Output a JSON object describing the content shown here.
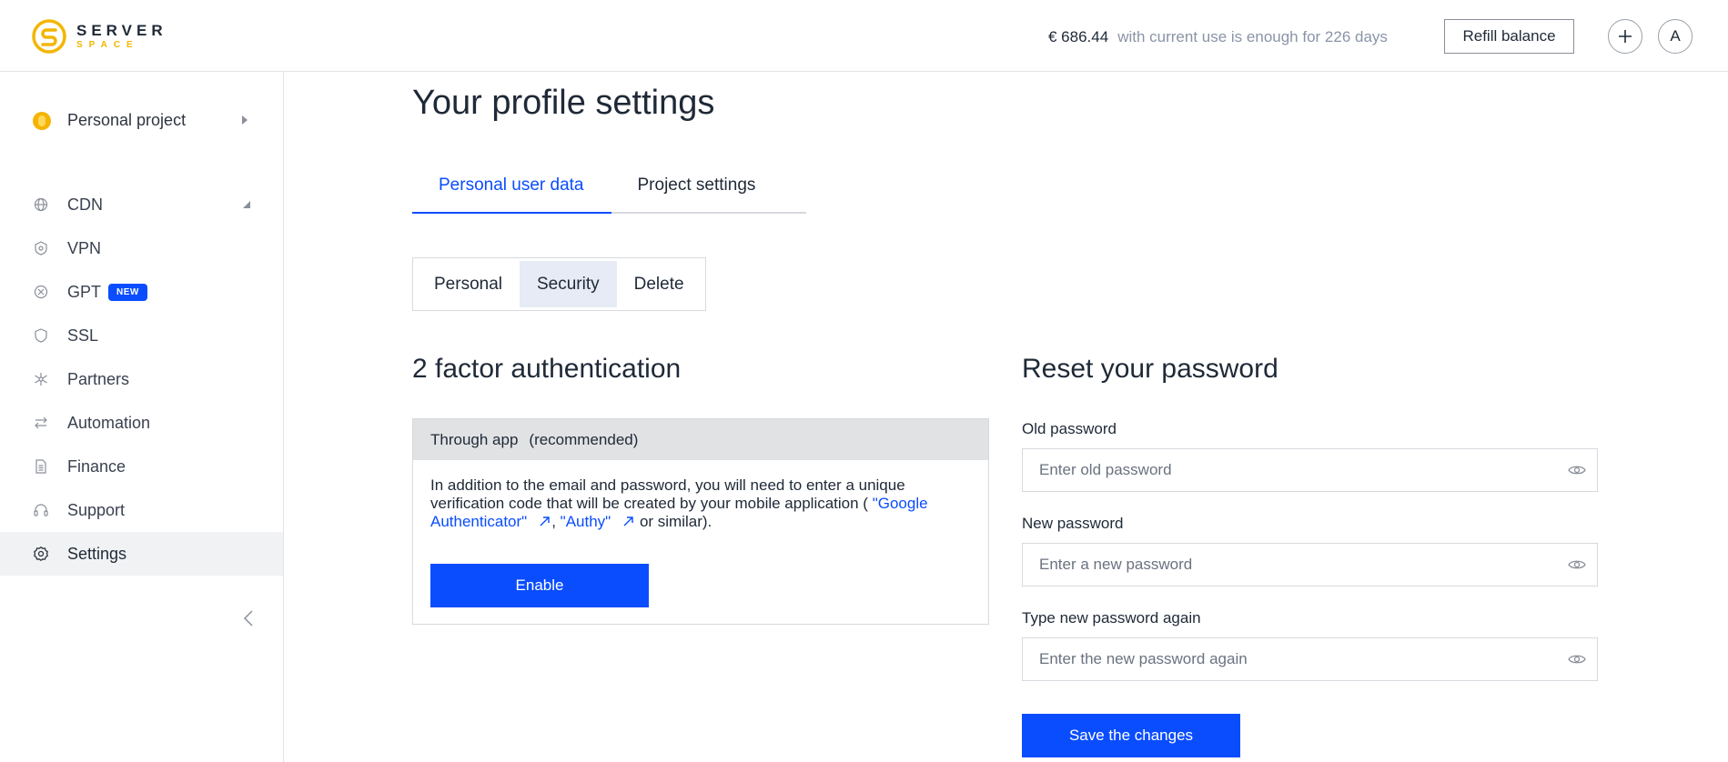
{
  "header": {
    "logo_line1": "SERVER",
    "logo_line2": "SPACE",
    "balance_amount": "€ 686.44",
    "balance_note": "with current use is enough for 226 days",
    "refill_label": "Refill balance",
    "add_label": "+",
    "avatar_initial": "A"
  },
  "sidebar": {
    "project_name": "Personal project",
    "items": [
      {
        "label": "CDN",
        "icon": "globe-icon"
      },
      {
        "label": "VPN",
        "icon": "shield-network-icon"
      },
      {
        "label": "GPT",
        "icon": "ai-spiral-icon",
        "badge": "NEW"
      },
      {
        "label": "SSL",
        "icon": "shield-icon"
      },
      {
        "label": "Partners",
        "icon": "network-icon"
      },
      {
        "label": "Automation",
        "icon": "arrows-swap-icon"
      },
      {
        "label": "Finance",
        "icon": "document-icon"
      },
      {
        "label": "Support",
        "icon": "headset-icon"
      },
      {
        "label": "Settings",
        "icon": "gear-icon",
        "active": true
      }
    ]
  },
  "main": {
    "title": "Your profile settings",
    "tabs": [
      {
        "label": "Personal user data",
        "active": true
      },
      {
        "label": "Project settings"
      }
    ],
    "subtabs": [
      {
        "label": "Personal"
      },
      {
        "label": "Security",
        "active": true
      },
      {
        "label": "Delete"
      }
    ],
    "tfa": {
      "heading": "2 factor authentication",
      "method": "Through app",
      "recommended": "(recommended)",
      "text_before": "In addition to the email and password, you will need to enter a unique verification code that will be created by your mobile application ( ",
      "link1": "\"Google Authenticator\"",
      "separator": ", ",
      "link2": "\"Authy\"",
      "text_after": " or similar).",
      "enable_label": "Enable"
    },
    "reset": {
      "heading": "Reset your password",
      "old_label": "Old password",
      "old_placeholder": "Enter old password",
      "new_label": "New password",
      "new_placeholder": "Enter a new password",
      "repeat_label": "Type new password again",
      "repeat_placeholder": "Enter the new password again",
      "save_label": "Save the changes"
    }
  },
  "colors": {
    "accent": "#0a4dff",
    "logo_yellow": "#f2b600",
    "muted_text": "#8a94a6"
  }
}
